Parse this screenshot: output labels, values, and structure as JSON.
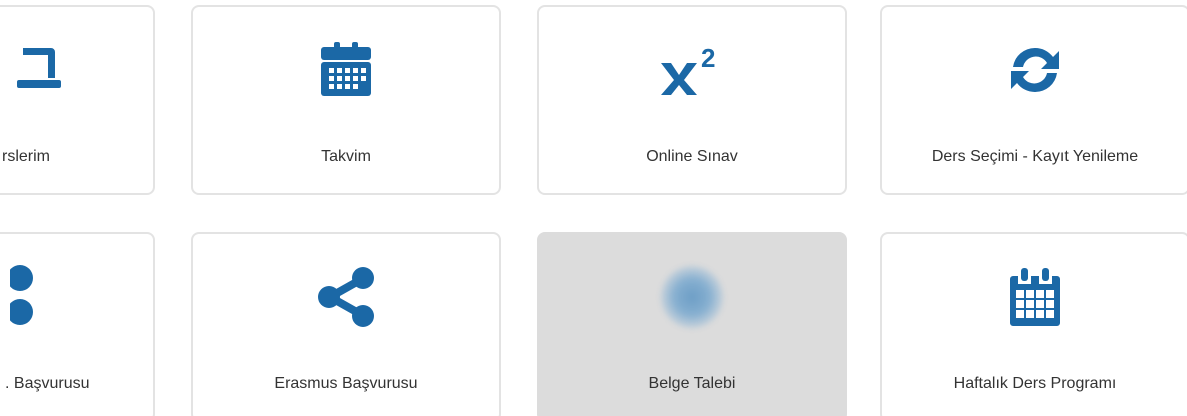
{
  "colors": {
    "icon": "#1b68a6",
    "tile_border": "#e3e3e3",
    "tile_active_bg": "#dcdcdc",
    "label": "#333333"
  },
  "tiles": [
    {
      "label": "rslerim",
      "icon": "laptop-icon"
    },
    {
      "label": "Takvim",
      "icon": "calendar-icon"
    },
    {
      "label": "Online Sınav",
      "icon": "superscript-icon"
    },
    {
      "label": "Ders Seçimi - Kayıt Yenileme",
      "icon": "refresh-icon"
    },
    {
      "label": ". Başvurusu",
      "icon": "share-icon"
    },
    {
      "label": "Erasmus Başvurusu",
      "icon": "share-icon"
    },
    {
      "label": "Belge Talebi",
      "icon": "blurred-icon"
    },
    {
      "label": "Haftalık Ders Programı",
      "icon": "weekly-calendar-icon"
    }
  ]
}
